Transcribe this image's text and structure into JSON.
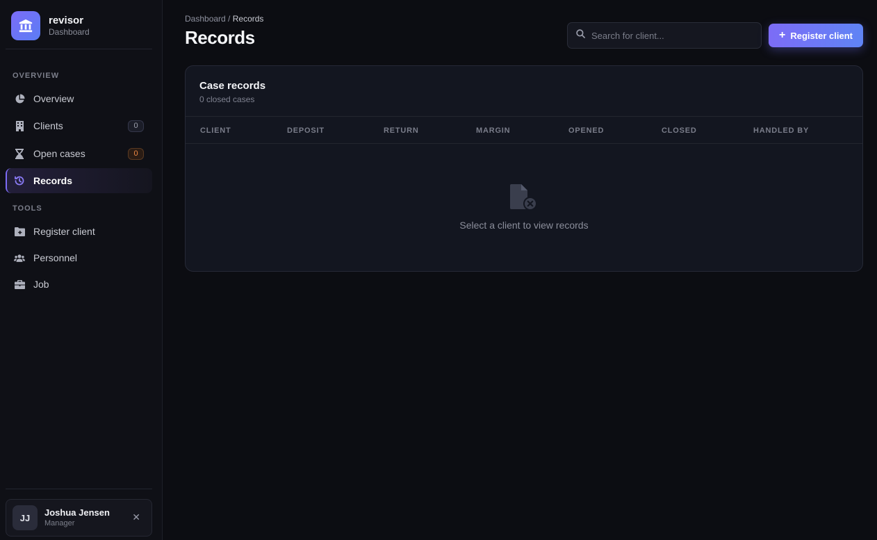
{
  "brand": {
    "name": "revisor",
    "subtitle": "Dashboard"
  },
  "sidebar": {
    "sections": [
      {
        "label": "OVERVIEW"
      },
      {
        "label": "TOOLS"
      }
    ],
    "overview_items": [
      {
        "label": "Overview",
        "icon": "pie-chart-icon"
      },
      {
        "label": "Clients",
        "icon": "building-icon",
        "badge": "0"
      },
      {
        "label": "Open cases",
        "icon": "hourglass-icon",
        "badge": "0"
      },
      {
        "label": "Records",
        "icon": "history-icon",
        "active": true
      }
    ],
    "tool_items": [
      {
        "label": "Register client",
        "icon": "folder-plus-icon"
      },
      {
        "label": "Personnel",
        "icon": "users-icon"
      },
      {
        "label": "Job",
        "icon": "briefcase-icon"
      }
    ]
  },
  "user": {
    "initials": "JJ",
    "name": "Joshua Jensen",
    "role": "Manager",
    "close_glyph": "✕"
  },
  "breadcrumb": {
    "parent": "Dashboard",
    "separator": " / ",
    "current": "Records"
  },
  "page": {
    "title": "Records"
  },
  "search": {
    "placeholder": "Search for client..."
  },
  "actions": {
    "register_label": "Register client",
    "register_icon": "+"
  },
  "card": {
    "title": "Case records",
    "subtitle": "0 closed cases",
    "columns": [
      "CLIENT",
      "DEPOSIT",
      "RETURN",
      "MARGIN",
      "OPENED",
      "CLOSED",
      "HANDLED BY"
    ],
    "empty_text": "Select a client to view records"
  },
  "colors": {
    "accent": "#7c6bf5",
    "background": "#0c0d12",
    "warning": "#f08a45"
  }
}
